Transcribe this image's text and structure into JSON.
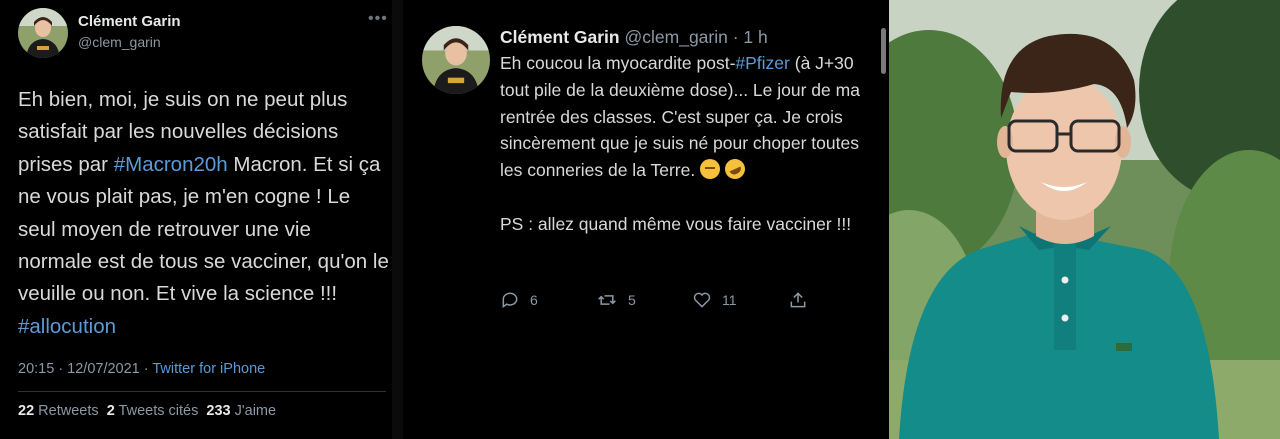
{
  "left_tweet": {
    "name": "Clément Garin",
    "handle": "@clem_garin",
    "text_before": "Eh bien, moi, je suis on ne peut plus satisfait par les nouvelles décisions prises par ",
    "hashtag1": "#Macron20h",
    "text_middle": " Macron. Et si ça ne vous plait pas, je m'en cogne ! Le seul moyen de retrouver une vie normale est de tous se vacciner, qu'on le veuille ou non. Et vive la science !!! ",
    "hashtag2": "#allocution",
    "timestamp": "20:15 · 12/07/2021 · ",
    "via": "Twitter for iPhone",
    "retweets_count": "22",
    "retweets_label": "Retweets",
    "quotes_count": "2",
    "quotes_label": "Tweets cités",
    "likes_count": "233",
    "likes_label": "J'aime"
  },
  "mid_tweet": {
    "name": "Clément Garin",
    "handle_time": "@clem_garin · 1 h",
    "text_before": "Eh coucou la myocardite post-",
    "hashtag": "#Pfizer",
    "text_after": " (à J+30 tout pile de la deuxième dose)... Le jour de ma rentrée des classes. C'est super ça. Je crois sincèrement que je suis né pour choper toutes les conneries de la Terre. ",
    "ps": "PS : allez quand même vous faire vacciner !!!",
    "replies": "6",
    "retweets": "5",
    "likes": "11"
  },
  "icons": [
    "more-icon",
    "reply-icon",
    "retweet-icon",
    "like-icon",
    "share-icon",
    "thinking-emoji",
    "rofl-emoji"
  ],
  "colors": {
    "link": "#5b9bd8",
    "background": "#000000",
    "muted": "#8b98a5"
  }
}
